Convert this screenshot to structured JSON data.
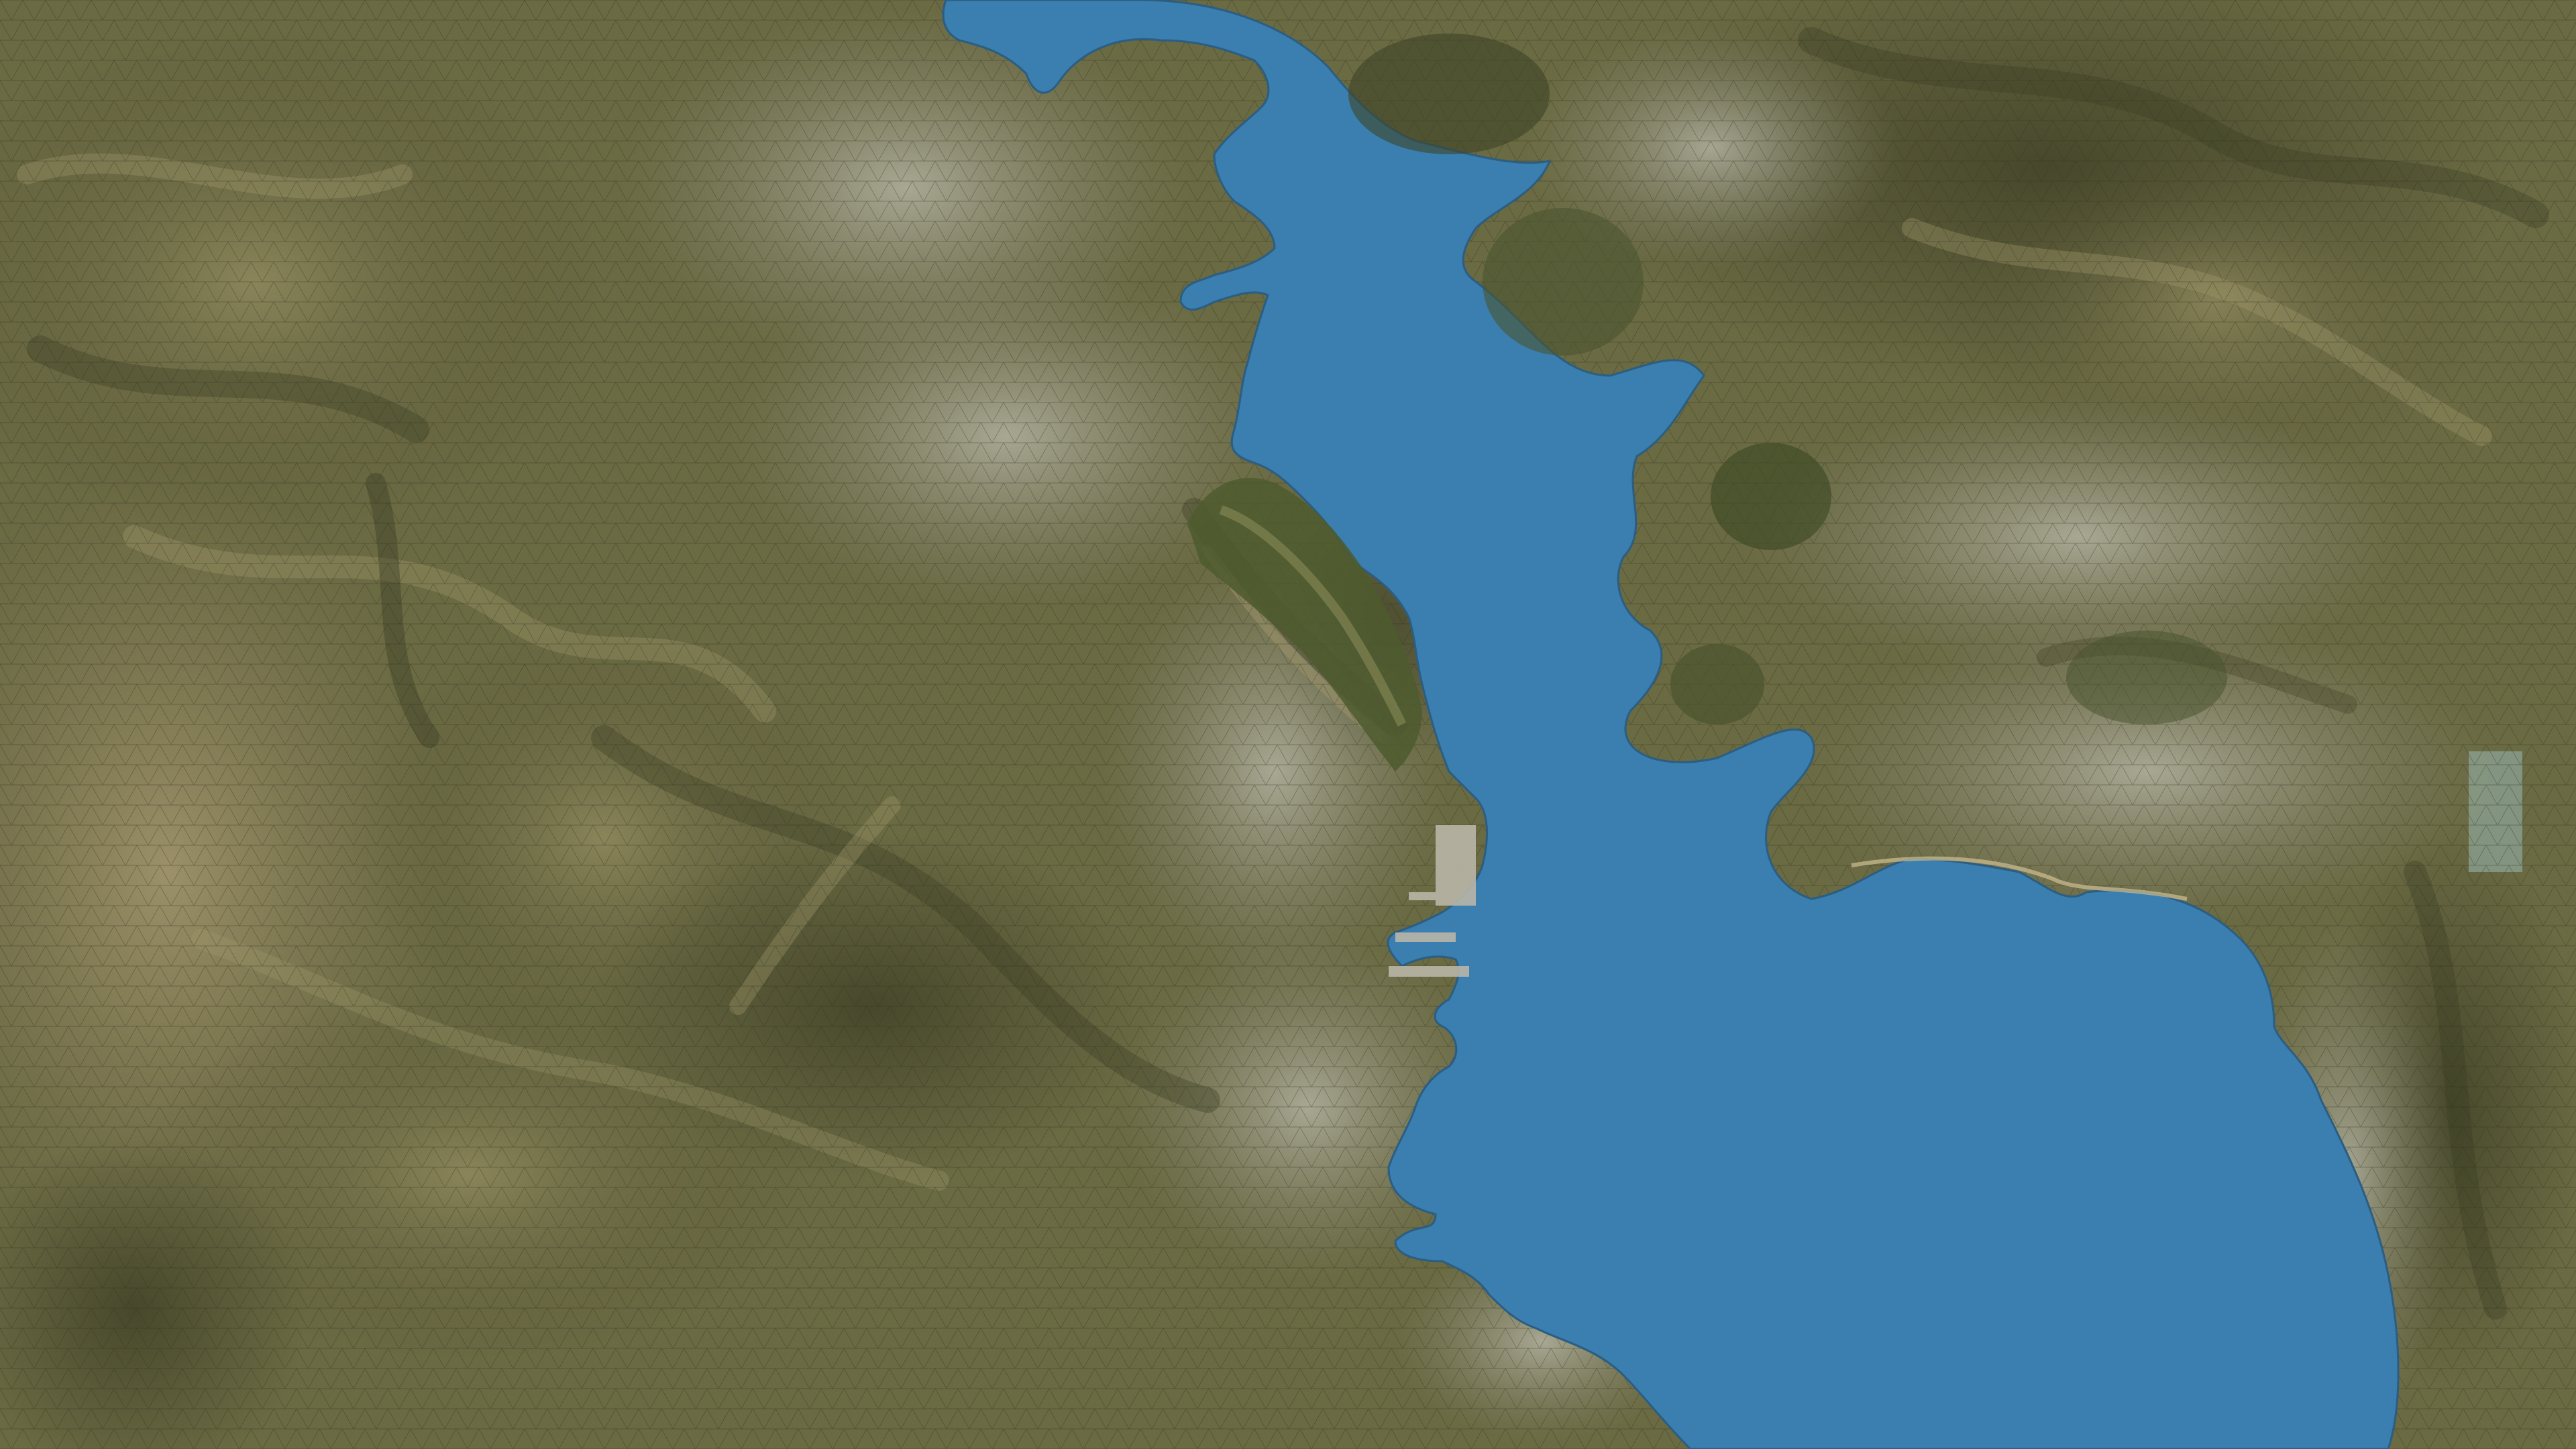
{
  "view": {
    "kind": "3d-terrain-mesh",
    "mode": "wireframe-overlay",
    "labels_visible": false,
    "ui_chrome_visible": false
  },
  "colors": {
    "water": "#3a7fb0",
    "water_wire": "#1d4b6b",
    "land_base": "#6f6d45",
    "land_dark": "#4a4b2c",
    "land_light": "#9a9265",
    "urban": "#a7a595",
    "urban_light": "#c4c2b4",
    "bare_ground": "#9c8c66",
    "land_wire": "#2c2d1d"
  }
}
